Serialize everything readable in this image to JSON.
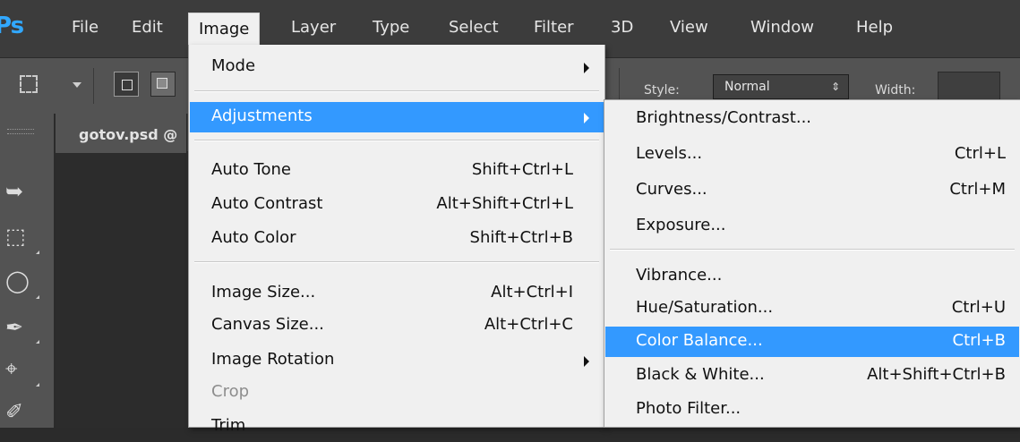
{
  "app": {
    "logo": "Ps"
  },
  "menubar": {
    "items": [
      "File",
      "Edit",
      "Image",
      "Layer",
      "Type",
      "Select",
      "Filter",
      "3D",
      "View",
      "Window",
      "Help"
    ],
    "active": "Image"
  },
  "options_bar": {
    "style_label": "Style:",
    "style_value": "Normal",
    "width_label": "Width:"
  },
  "document": {
    "tab_title": "gotov.psd @"
  },
  "image_menu": {
    "items": [
      {
        "label": "Mode",
        "shortcut": "",
        "submenu": true
      },
      {
        "label": "Adjustments",
        "shortcut": "",
        "submenu": true,
        "highlighted": true
      },
      {
        "label": "Auto Tone",
        "shortcut": "Shift+Ctrl+L"
      },
      {
        "label": "Auto Contrast",
        "shortcut": "Alt+Shift+Ctrl+L"
      },
      {
        "label": "Auto Color",
        "shortcut": "Shift+Ctrl+B"
      },
      {
        "label": "Image Size...",
        "shortcut": "Alt+Ctrl+I"
      },
      {
        "label": "Canvas Size...",
        "shortcut": "Alt+Ctrl+C"
      },
      {
        "label": "Image Rotation",
        "shortcut": "",
        "submenu": true
      },
      {
        "label": "Crop",
        "shortcut": "",
        "disabled": true
      },
      {
        "label": "Trim",
        "shortcut": ""
      }
    ]
  },
  "adjustments_menu": {
    "items": [
      {
        "label": "Brightness/Contrast...",
        "shortcut": ""
      },
      {
        "label": "Levels...",
        "shortcut": "Ctrl+L"
      },
      {
        "label": "Curves...",
        "shortcut": "Ctrl+M"
      },
      {
        "label": "Exposure...",
        "shortcut": ""
      },
      {
        "label": "Vibrance...",
        "shortcut": ""
      },
      {
        "label": "Hue/Saturation...",
        "shortcut": "Ctrl+U"
      },
      {
        "label": "Color Balance...",
        "shortcut": "Ctrl+B",
        "highlighted": true
      },
      {
        "label": "Black & White...",
        "shortcut": "Alt+Shift+Ctrl+B"
      },
      {
        "label": "Photo Filter...",
        "shortcut": ""
      }
    ]
  },
  "colors": {
    "menu_bg": "#f0f0f0",
    "highlight": "#3399ff",
    "chrome_dark": "#3c3c3c",
    "panel": "#535353"
  }
}
